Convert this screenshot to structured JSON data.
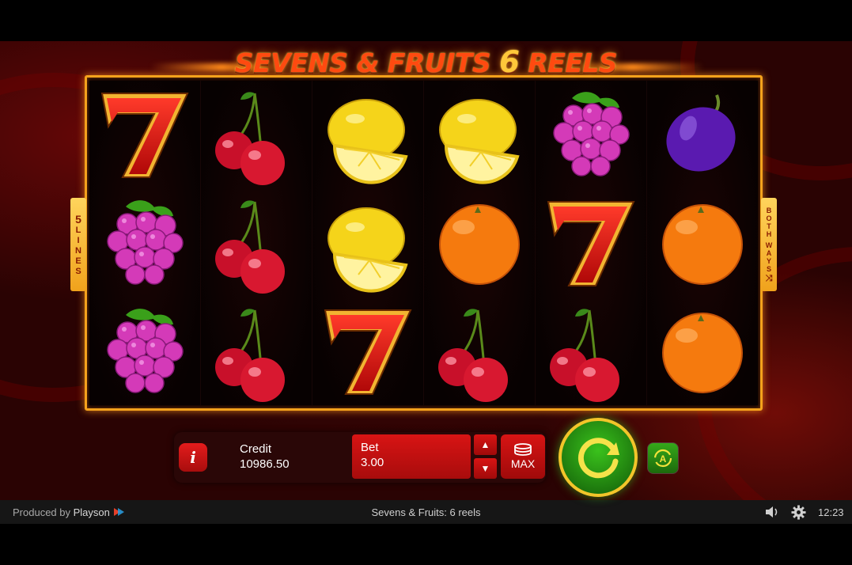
{
  "game": {
    "title_left": "SEVENS & FRUITS",
    "title_num": "6",
    "title_right": "REELS"
  },
  "reels": [
    [
      "seven-icon",
      "grapes-icon",
      "grapes-icon"
    ],
    [
      "cherry-icon",
      "cherry-icon",
      "cherry-icon"
    ],
    [
      "lemon-icon",
      "lemon-icon",
      "seven-icon"
    ],
    [
      "lemon-icon",
      "orange-icon",
      "cherry-icon"
    ],
    [
      "grapes-icon",
      "seven-icon",
      "cherry-icon"
    ],
    [
      "plum-icon",
      "orange-icon",
      "orange-icon"
    ]
  ],
  "side_left": {
    "num": "5",
    "word": "LINES"
  },
  "side_right": {
    "word1": "BOTH",
    "word2": "WAYS"
  },
  "controls": {
    "info": "i",
    "credit_label": "Credit",
    "credit_value": "10986.50",
    "bet_label": "Bet",
    "bet_value": "3.00",
    "max_label": "MAX",
    "auto_label": "A"
  },
  "footer": {
    "produced_by": "Produced by",
    "producer": "Playson",
    "game_name": "Sevens & Fruits: 6 reels",
    "time": "12:23"
  },
  "colors": {
    "frame": "#f4a21c",
    "button_red": "#d81414",
    "spin_green": "#2aa016"
  }
}
